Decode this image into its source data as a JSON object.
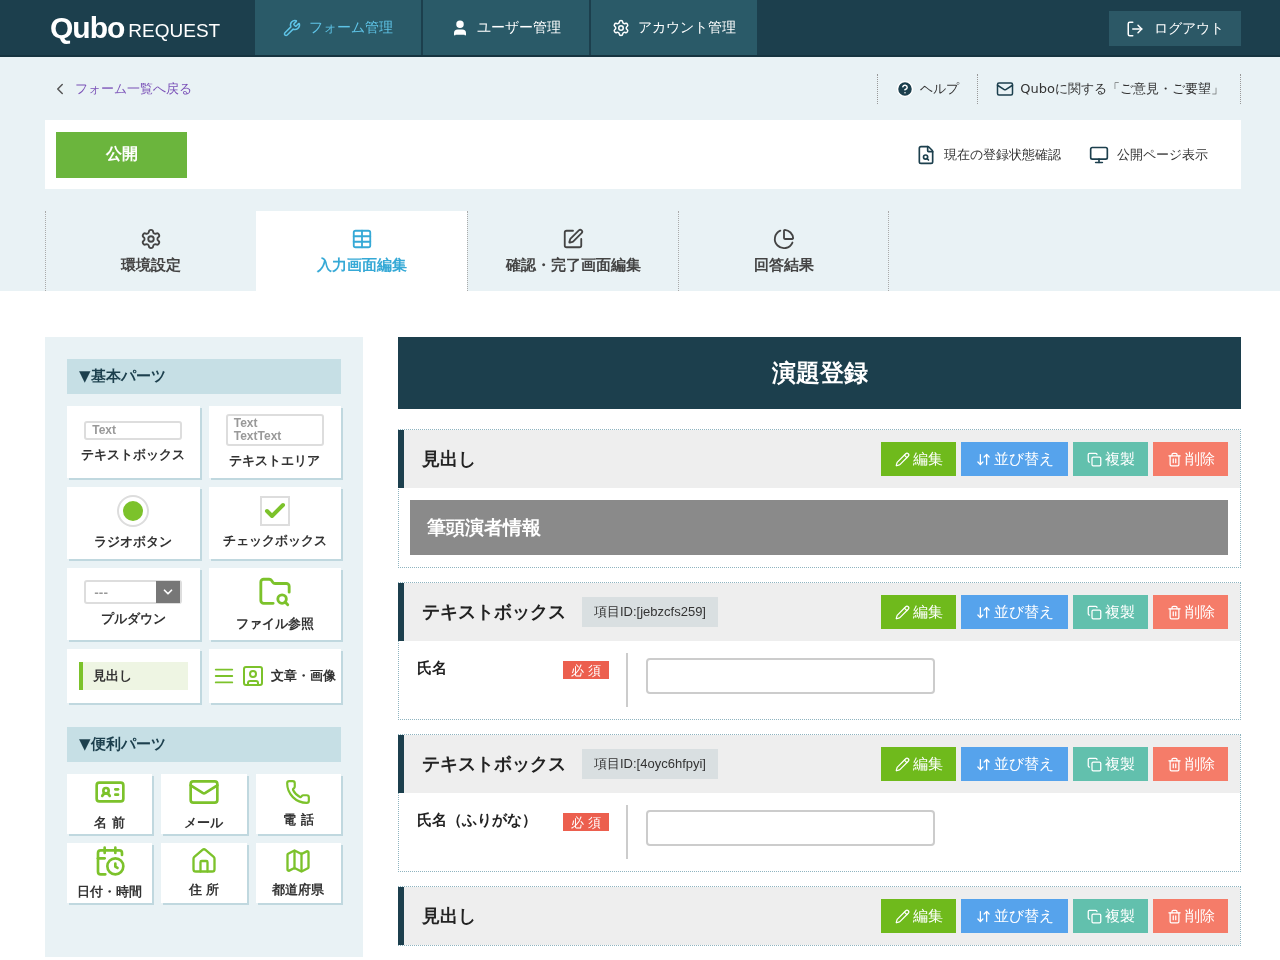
{
  "header": {
    "logo": {
      "brand": "Qubo",
      "suffix": "REQUEST"
    },
    "nav": [
      {
        "label": "フォーム管理",
        "selected": true
      },
      {
        "label": "ユーザー管理",
        "selected": false
      },
      {
        "label": "アカウント管理",
        "selected": false
      }
    ],
    "logout": "ログアウト"
  },
  "subbar": {
    "back_link": "フォーム一覧へ戻る",
    "links": [
      {
        "label": "ヘルプ"
      },
      {
        "label": "Quboに関する「ご意見・ご要望」"
      }
    ]
  },
  "actions": {
    "publish": "公開",
    "links": [
      {
        "label": "現在の登録状態確認"
      },
      {
        "label": "公開ページ表示"
      }
    ]
  },
  "tabs": [
    {
      "label": "環境設定",
      "selected": false
    },
    {
      "label": "入力画面編集",
      "selected": true
    },
    {
      "label": "確認・完了画面編集",
      "selected": false
    },
    {
      "label": "回答結果",
      "selected": false
    }
  ],
  "sidebar": [
    {
      "title": "▼基本パーツ",
      "items": [
        {
          "label": "テキストボックス",
          "kind": "textbox",
          "preview": [
            "Text"
          ]
        },
        {
          "label": "テキストエリア",
          "kind": "textarea",
          "preview": [
            "Text",
            "TextText"
          ]
        },
        {
          "label": "ラジオボタン",
          "kind": "radio"
        },
        {
          "label": "チェックボックス",
          "kind": "checkbox"
        },
        {
          "label": "プルダウン",
          "kind": "dropdown",
          "preview": [
            "---"
          ]
        },
        {
          "label": "ファイル参照",
          "kind": "file"
        },
        {
          "label": "見出し",
          "kind": "heading"
        },
        {
          "label": "文章・画像",
          "kind": "text-image"
        }
      ]
    },
    {
      "title": "▼便利パーツ",
      "items": [
        {
          "label": "名 前",
          "kind": "name"
        },
        {
          "label": "メール",
          "kind": "mail"
        },
        {
          "label": "電 話",
          "kind": "phone"
        },
        {
          "label": "日付・時間",
          "kind": "datetime"
        },
        {
          "label": "住 所",
          "kind": "address"
        },
        {
          "label": "都道府県",
          "kind": "prefecture"
        }
      ]
    }
  ],
  "main": {
    "title": "演題登録",
    "blocks": [
      {
        "kind": "heading",
        "title": "見出し",
        "heading_text": "筆頭演者情報",
        "buttons": [
          {
            "label": "編集",
            "kind": "edit"
          },
          {
            "label": "並び替え",
            "kind": "sort"
          },
          {
            "label": "複製",
            "kind": "copy"
          },
          {
            "label": "削除",
            "kind": "delete"
          }
        ]
      },
      {
        "kind": "field",
        "title": "テキストボックス",
        "item_id": "項目ID:[jebzcfs259]",
        "label": "氏名",
        "required": true,
        "required_badge": "必 須",
        "buttons": [
          {
            "label": "編集",
            "kind": "edit"
          },
          {
            "label": "並び替え",
            "kind": "sort"
          },
          {
            "label": "複製",
            "kind": "copy"
          },
          {
            "label": "削除",
            "kind": "delete"
          }
        ]
      },
      {
        "kind": "field",
        "title": "テキストボックス",
        "item_id": "項目ID:[4oyc6hfpyi]",
        "label": "氏名（ふりがな）",
        "required": true,
        "required_badge": "必 須",
        "buttons": [
          {
            "label": "編集",
            "kind": "edit"
          },
          {
            "label": "並び替え",
            "kind": "sort"
          },
          {
            "label": "複製",
            "kind": "copy"
          },
          {
            "label": "削除",
            "kind": "delete"
          }
        ]
      },
      {
        "kind": "heading",
        "title": "見出し",
        "buttons": [
          {
            "label": "編集",
            "kind": "edit"
          },
          {
            "label": "並び替え",
            "kind": "sort"
          },
          {
            "label": "複製",
            "kind": "copy"
          },
          {
            "label": "削除",
            "kind": "delete"
          }
        ]
      }
    ]
  }
}
